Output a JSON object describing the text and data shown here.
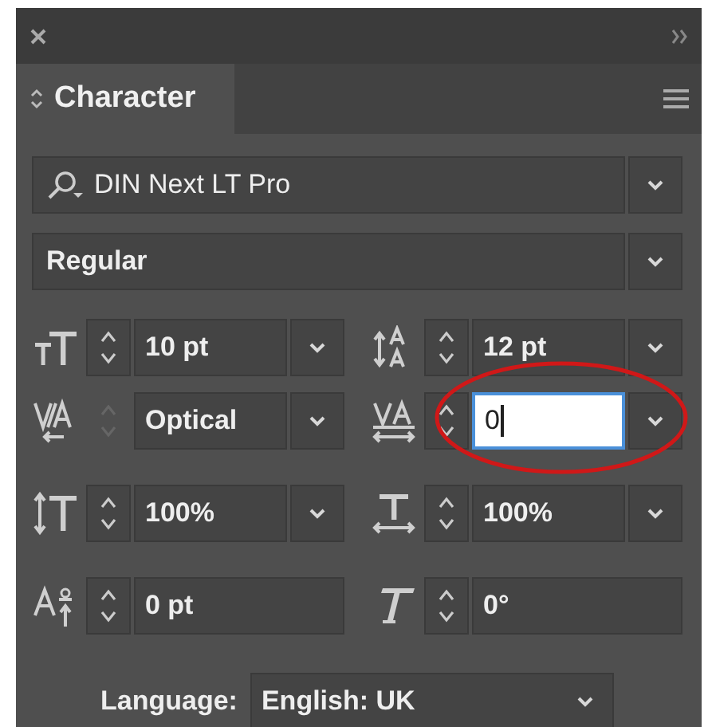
{
  "panel": {
    "tab": {
      "label": "Character",
      "selected": true
    }
  },
  "font_family": {
    "value": "DIN Next LT Pro"
  },
  "font_style": {
    "value": "Regular"
  },
  "fields": [
    {
      "kind": "font-size",
      "value": "10 pt",
      "dropdown": true,
      "disabled": false,
      "focused": false,
      "circled": false
    },
    {
      "kind": "leading",
      "value": "12 pt",
      "dropdown": true,
      "disabled": false,
      "focused": false,
      "circled": false
    },
    {
      "kind": "kerning",
      "value": "Optical",
      "dropdown": true,
      "disabled": true,
      "focused": false,
      "circled": false
    },
    {
      "kind": "tracking",
      "value": "0",
      "dropdown": true,
      "disabled": false,
      "focused": true,
      "circled": true
    },
    {
      "kind": "vertical-scale",
      "value": "100%",
      "dropdown": true,
      "disabled": false,
      "focused": false,
      "circled": false
    },
    {
      "kind": "horizontal-scale",
      "value": "100%",
      "dropdown": true,
      "disabled": false,
      "focused": false,
      "circled": false
    },
    {
      "kind": "baseline-shift",
      "value": "0 pt",
      "dropdown": false,
      "disabled": false,
      "focused": false,
      "circled": false
    },
    {
      "kind": "skew",
      "value": "0°",
      "dropdown": false,
      "disabled": false,
      "focused": false,
      "circled": false
    }
  ],
  "language": {
    "label": "Language:",
    "value": "English: UK"
  }
}
